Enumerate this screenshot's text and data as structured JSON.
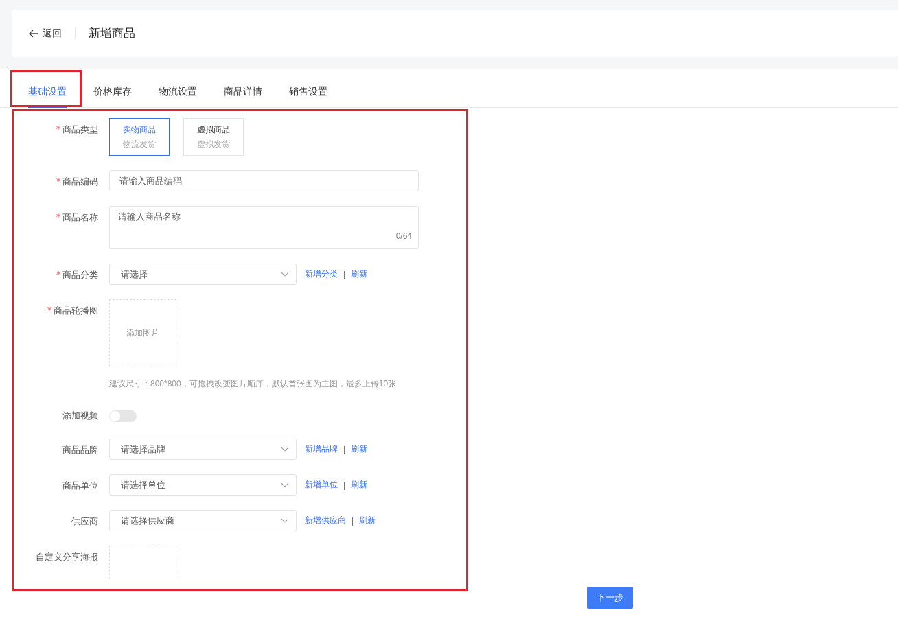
{
  "header": {
    "back": "返回",
    "title": "新增商品"
  },
  "tabs": [
    {
      "label": "基础设置",
      "selected": true
    },
    {
      "label": "价格库存",
      "selected": false
    },
    {
      "label": "物流设置",
      "selected": false
    },
    {
      "label": "商品详情",
      "selected": false
    },
    {
      "label": "销售设置",
      "selected": false
    }
  ],
  "form": [
    {
      "kind": "cards",
      "label": "商品类型",
      "required": true,
      "options": [
        {
          "title": "实物商品",
          "subtitle": "物流发货",
          "selected": true
        },
        {
          "title": "虚拟商品",
          "subtitle": "虚拟发货",
          "selected": false
        }
      ]
    },
    {
      "kind": "input",
      "label": "商品编码",
      "required": true,
      "placeholder": "请输入商品编码"
    },
    {
      "kind": "textarea",
      "label": "商品名称",
      "required": true,
      "placeholder": "请输入商品名称",
      "counter": "0/64"
    },
    {
      "kind": "select",
      "label": "商品分类",
      "required": true,
      "placeholder": "请选择",
      "links": [
        "新增分类",
        "刷新"
      ],
      "separator": "|"
    },
    {
      "kind": "upload",
      "label": "商品轮播图",
      "required": true,
      "button": "添加图片",
      "hint": "建议尺寸：800*800，可拖拽改变图片顺序，默认首张图为主图，最多上传10张"
    },
    {
      "kind": "switch",
      "label": "添加视频",
      "required": false,
      "on": false
    },
    {
      "kind": "select",
      "label": "商品品牌",
      "required": false,
      "placeholder": "请选择品牌",
      "links": [
        "新增品牌",
        "刷新"
      ],
      "separator": "|"
    },
    {
      "kind": "select",
      "label": "商品单位",
      "required": false,
      "placeholder": "请选择单位",
      "links": [
        "新增单位",
        "刷新"
      ],
      "separator": "|"
    },
    {
      "kind": "select",
      "label": "供应商",
      "required": false,
      "placeholder": "请选择供应商",
      "links": [
        "新增供应商",
        "刷新"
      ],
      "separator": "|"
    },
    {
      "kind": "upload",
      "label": "自定义分享海报",
      "required": false
    }
  ],
  "footer": {
    "next_button": "下一步"
  }
}
